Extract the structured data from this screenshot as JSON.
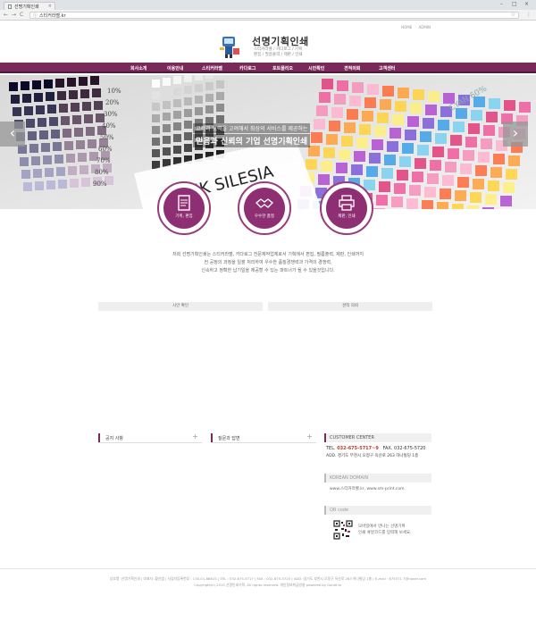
{
  "browser": {
    "tab_title": "선명기획인쇄",
    "tab_close": "×",
    "url": "스티커라벨.kr",
    "info_icon": "ⓘ",
    "back_icon": "←",
    "forward_icon": "→",
    "reload_icon": "C",
    "star_icon": "☆",
    "menu_icon": "⋮",
    "minimize": "–",
    "maximize": "□",
    "close": "×"
  },
  "toplinks": [
    "HOME",
    "ADMIN"
  ],
  "brand": {
    "title": "선명기획인쇄",
    "sub1": "스티커라벨 / 카다로그 / 기획",
    "sub2": "편집 / 필름출력 / 제판 / 인쇄"
  },
  "nav": [
    "회사소개",
    "이용안내",
    "스티커라벨",
    "카다로그",
    "포트폴리오",
    "시안확인",
    "견적의뢰",
    "고객센터"
  ],
  "hero": {
    "caption1": "고객과 노력을 고려해서 최상의 서비스를 제공하는",
    "caption2": "믿음과 신뢰의 기업 선명기획인쇄",
    "prev": "‹",
    "next": "›",
    "print_word": "RUK SILESIA",
    "percents": [
      "10%",
      "20%",
      "30%",
      "40%",
      "50%",
      "60%",
      "70%",
      "80%",
      "90%"
    ],
    "cyan_label": "CYAN 60%"
  },
  "features": [
    "기획, 편집",
    "우수한 품질",
    "제판, 인쇄"
  ],
  "intro": [
    "저희 선명기획인쇄는 스티커라벨, 카다로그 전문제작업체로서 기획에서 편집, 필름출력, 제판, 인쇄까지",
    "전 공정의 과정을 일괄 처리하여 우수한 품질경쟁력과 가격의 경쟁력,",
    "신속하고 정확한 납기일을 제공할 수 있는 파트너가 될 수 있을것입니다."
  ],
  "sections": {
    "proof": "시안 확인",
    "estimate": "견적 의뢰",
    "notice": "공지 사항",
    "qna": "질문과 답변",
    "plus": "+"
  },
  "customer_center": {
    "title": "CUSTOMER CENTER",
    "tel_label": "TEL",
    "tel": "032-675-5717~9",
    "fax": "FAX. 032-675-5720",
    "addr": "ADD. 경기도 부천시 오정구 옥산로 263 하나빌딩 1층"
  },
  "korean_domain": {
    "title": "KOREAN DOMAIN",
    "value": "www.스티커라벨.kr,   www.sm-print.com"
  },
  "qr": {
    "title": "QR code",
    "line1": "모바일에서 만나는 선명기획",
    "line2": "인쇄 큐알코드를 입력해 보세요."
  },
  "footer": {
    "line1": "상호명 :선명기획인쇄 | 대표자 :황선범 | 사업자등록번호 : 130-01-88815 | TEL : 032-675-5717 | FAX : 032-675-5720 | ADD :경기도 부천시 오정구 옥산로 263 하나빌딩 1층 | E-mail : 675571 7@naver.com",
    "line2": "Copyright(c) 2015 선명인쇄기획. All rights reserved.   개인정보취급방침  powered by Gonet.kr"
  },
  "colors": {
    "brand": "#7a2a5a",
    "feature": "#8e2f73",
    "tel": "#c0392b"
  }
}
